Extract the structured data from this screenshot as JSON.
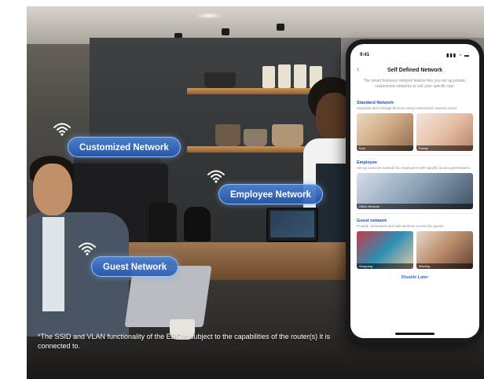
{
  "networks": [
    {
      "label": "Customized Network"
    },
    {
      "label": "Employee Network"
    },
    {
      "label": "Guest Network"
    }
  ],
  "footnote": "*The SSID and VLAN functionality of the EBG is subject to the capabilities of the router(s) it is connected to.",
  "phone": {
    "status_time": "9:41",
    "status_icons": "▮▮▮ ◔ ▬",
    "title": "Self Defined Network",
    "intro": "The smart business network feature lets you set up private, customized networks to suit your specific use.",
    "sections": [
      {
        "title": "Standard Network",
        "desc": "Separate and manage devices using customized network zones",
        "thumbs": [
          "Kids",
          "Family"
        ]
      },
      {
        "title": "Employee",
        "desc": "Set up a secure network for employees with specific access permissions",
        "thumbs": [
          "Office Network"
        ]
      },
      {
        "title": "Guest network",
        "desc": "Provide convenient and safe wireless access for guests",
        "thumbs": [
          "Shopping",
          "Meeting"
        ]
      }
    ],
    "footer_link": "Disable Later"
  },
  "colors": {
    "pill_blue": "#3a78cc",
    "link_blue": "#2f6fd1",
    "section_title": "#1f4fb0"
  }
}
